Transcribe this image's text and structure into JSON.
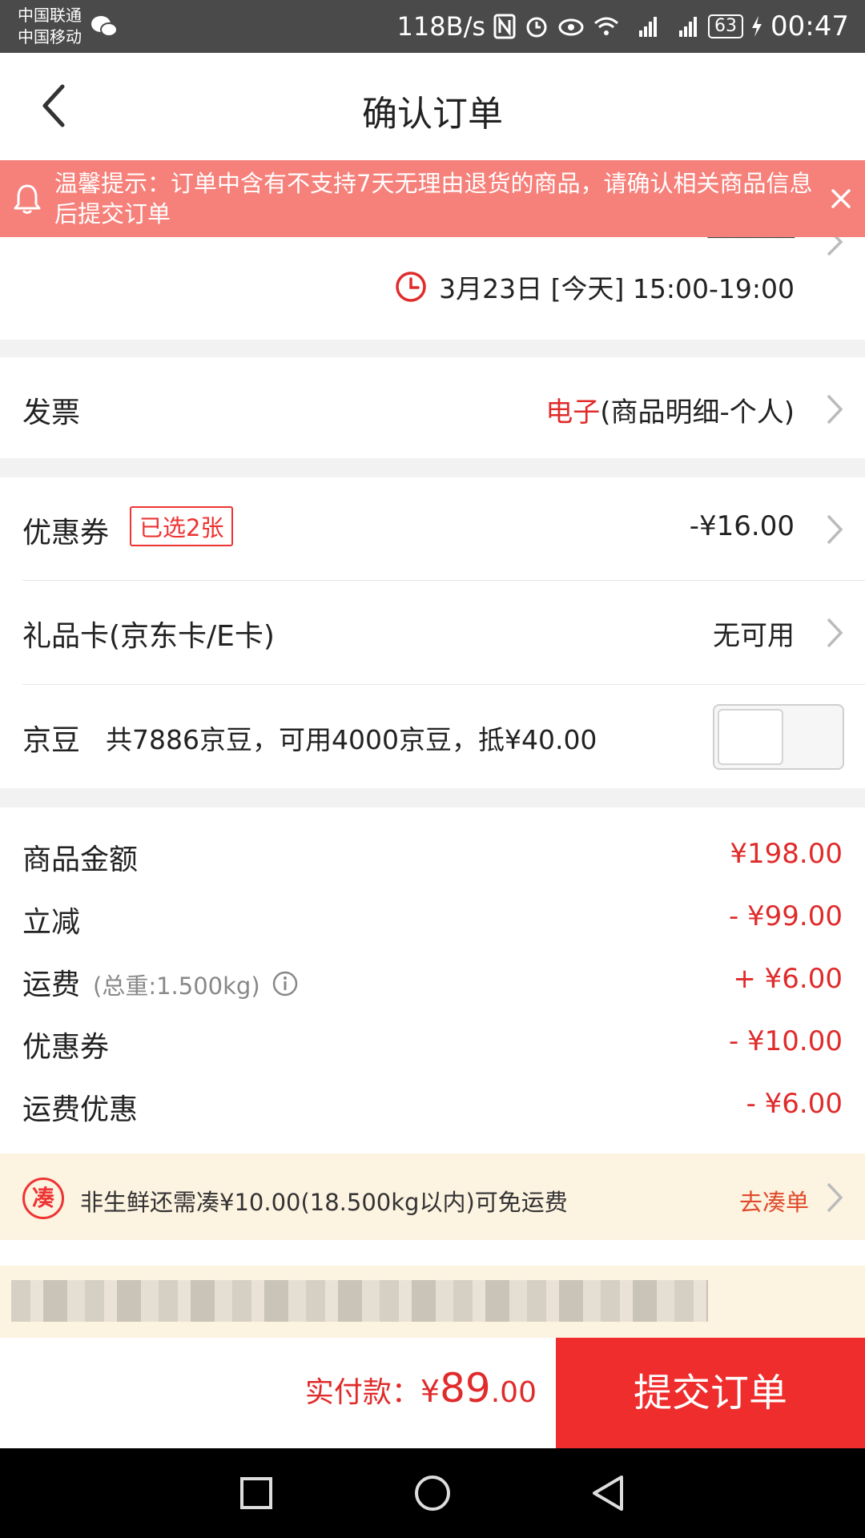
{
  "status_bar": {
    "carrier1": "中国联通",
    "carrier2": "中国移动",
    "net_speed": "118B/s",
    "battery": "63",
    "time": "00:47"
  },
  "header": {
    "title": "确认订单"
  },
  "banner": {
    "text": "温馨提示：订单中含有不支持7天无理由退货的商品，请确认相关商品信息后提交订单"
  },
  "delivery": {
    "time": "3月23日 [今天] 15:00-19:00"
  },
  "invoice": {
    "label": "发票",
    "value_type": "电子",
    "value_detail": "(商品明细-个人)"
  },
  "coupon": {
    "label": "优惠券",
    "badge": "已选2张",
    "value": "-¥16.00"
  },
  "giftcard": {
    "label": "礼品卡(京东卡/E卡)",
    "value": "无可用"
  },
  "beans": {
    "label": "京豆",
    "text": "共7886京豆，可用4000京豆，抵¥40.00",
    "enabled": false
  },
  "summary": [
    {
      "label": "商品金额",
      "value": "¥198.00"
    },
    {
      "label": "立减",
      "value": "- ¥99.00"
    },
    {
      "label": "运费",
      "note": "(总重:1.500kg)",
      "value": "+ ¥6.00"
    },
    {
      "label": "优惠券",
      "value": "- ¥10.00"
    },
    {
      "label": "运费优惠",
      "value": "- ¥6.00"
    }
  ],
  "freeship": {
    "icon_text": "凑",
    "text": "非生鲜还需凑¥10.00(18.500kg以内)可免运费",
    "link": "去凑单"
  },
  "footer": {
    "pay_label": "实付款：",
    "pay_currency": "¥",
    "pay_int": "89",
    "pay_dec": ".00",
    "submit": "提交订单"
  },
  "colors": {
    "accent_red": "#e02b2b",
    "banner_bg": "#f6807a",
    "submit_bg": "#ef2d2d"
  }
}
